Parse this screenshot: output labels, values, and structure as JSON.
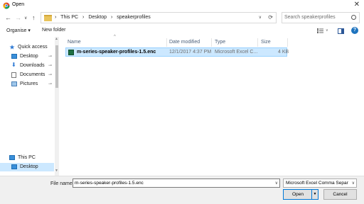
{
  "window": {
    "title": "Open",
    "close_glyph": "✕"
  },
  "nav": {
    "back": "←",
    "forward": "→",
    "recent": "∨",
    "up": "↑"
  },
  "address": {
    "crumbs": [
      "This PC",
      "Desktop",
      "speakerprofiles"
    ],
    "sep": "›",
    "drop": "∨",
    "refresh": "⟳"
  },
  "search": {
    "placeholder": "Search speakerprofiles"
  },
  "toolbar": {
    "organise": "Organise",
    "organise_arrow": "▾",
    "new_folder": "New folder",
    "help": "?"
  },
  "sidebar": {
    "items": [
      {
        "label": "Quick access",
        "icon": "star-icon",
        "color": "#2b78d4"
      },
      {
        "label": "Desktop",
        "icon": "desktop-icon",
        "color": "#3a8fd9",
        "pin": "📌"
      },
      {
        "label": "Downloads",
        "icon": "download-icon",
        "color": "#2b78d4",
        "pin": "📌"
      },
      {
        "label": "Documents",
        "icon": "documents-icon",
        "color": "#777777",
        "pin": "📌"
      },
      {
        "label": "Pictures",
        "icon": "pictures-icon",
        "color": "#4a7fb5",
        "pin": "📌"
      },
      {
        "label": "This PC",
        "icon": "computer-icon",
        "color": "#3a8fd9"
      },
      {
        "label": "Desktop",
        "icon": "desktop-icon",
        "color": "#3a8fd9",
        "selected": true
      }
    ]
  },
  "columns": {
    "name": "Name",
    "date": "Date modified",
    "type": "Type",
    "size": "Size",
    "sort": "^"
  },
  "files": [
    {
      "name": "m-series-speaker-profiles-1.5.enc",
      "date": "12/1/2017 4:37 PM",
      "type": "Microsoft Excel C...",
      "size": "4 KB"
    }
  ],
  "bottom": {
    "filename_label": "File name:",
    "filename_value": "m-series-speaker-profiles-1.5.enc",
    "filter_value": "Microsoft Excel Comma Separa",
    "open": "Open",
    "cancel": "Cancel",
    "dd": "∨"
  }
}
